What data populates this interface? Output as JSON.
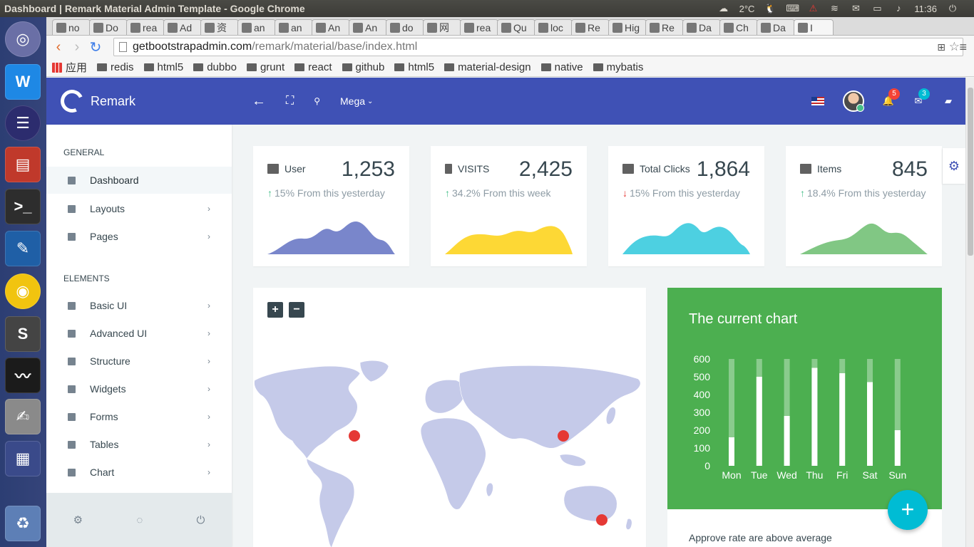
{
  "os": {
    "window_title": "Dashboard | Remark Material Admin Template - Google Chrome",
    "weather": "2°C",
    "clock": "11:36"
  },
  "browser": {
    "tabs": [
      "no",
      "Do",
      "rea",
      "Ad",
      "资",
      "an",
      "an",
      "An",
      "An",
      "do",
      "网",
      "rea",
      "Qu",
      "loc",
      "Re",
      "Hig",
      "Re",
      "Da",
      "Ch",
      "Da",
      "I"
    ],
    "url_host": "getbootstrapadmin.com",
    "url_path": "/remark/material/base/index.html",
    "bookmarks": [
      "应用",
      "redis",
      "html5",
      "dubbo",
      "grunt",
      "react",
      "github",
      "html5",
      "material-design",
      "native",
      "mybatis"
    ]
  },
  "navbar": {
    "brand": "Remark",
    "mega_label": "Mega",
    "notifications_count": "5",
    "messages_count": "3"
  },
  "sidebar": {
    "general_title": "GENERAL",
    "elements_title": "ELEMENTS",
    "items": [
      {
        "label": "Dashboard"
      },
      {
        "label": "Layouts"
      },
      {
        "label": "Pages"
      },
      {
        "label": "Basic UI"
      },
      {
        "label": "Advanced UI"
      },
      {
        "label": "Structure"
      },
      {
        "label": "Widgets"
      },
      {
        "label": "Forms"
      },
      {
        "label": "Tables"
      },
      {
        "label": "Chart"
      }
    ]
  },
  "stats": [
    {
      "label": "User",
      "value": "1,253",
      "change": "15% From this yesterday",
      "trend": "up",
      "color": "#7986cb"
    },
    {
      "label": "VISITS",
      "value": "2,425",
      "change": "34.2% From this week",
      "trend": "up",
      "color": "#fdd835"
    },
    {
      "label": "Total Clicks",
      "value": "1,864",
      "change": "15% From this yesterday",
      "trend": "down",
      "color": "#4dd0e1"
    },
    {
      "label": "Items",
      "value": "845",
      "change": "18.4% From this yesterday",
      "trend": "up",
      "color": "#81c784"
    }
  ],
  "map": {
    "zoom_in": "+",
    "zoom_out": "−"
  },
  "current_chart": {
    "title": "The current chart",
    "footer_text": "Approve rate are above average"
  },
  "chart_data": {
    "type": "bar",
    "title": "The current chart",
    "categories": [
      "Mon",
      "Tue",
      "Wed",
      "Thu",
      "Fri",
      "Sat",
      "Sun"
    ],
    "y_ticks": [
      "0",
      "100",
      "200",
      "300",
      "400",
      "500",
      "600"
    ],
    "ylim": [
      0,
      600
    ],
    "series": [
      {
        "values": [
          160,
          500,
          280,
          550,
          520,
          470,
          200
        ]
      },
      {
        "values": [
          600,
          600,
          600,
          600,
          600,
          600,
          600
        ]
      }
    ],
    "colors": {
      "value": "#ffffff",
      "track": "rgba(255,255,255,0.35)",
      "background": "#4caf50"
    }
  }
}
